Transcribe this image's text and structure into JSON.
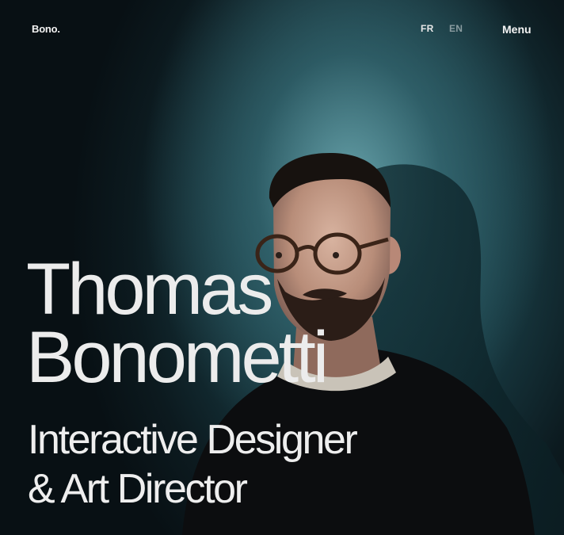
{
  "header": {
    "logo": "Bono.",
    "languages": [
      "FR",
      "EN"
    ],
    "menu_label": "Menu"
  },
  "hero": {
    "name_line_1": "Thomas",
    "name_line_2": "Bonometti",
    "role_line_1": "Interactive Designer",
    "role_line_2": "& Art Director"
  },
  "colors": {
    "background": "#0b1216",
    "backdrop_accent": "#2c5f69",
    "text": "#ececec",
    "lang_inactive": "#8a9ca0"
  }
}
